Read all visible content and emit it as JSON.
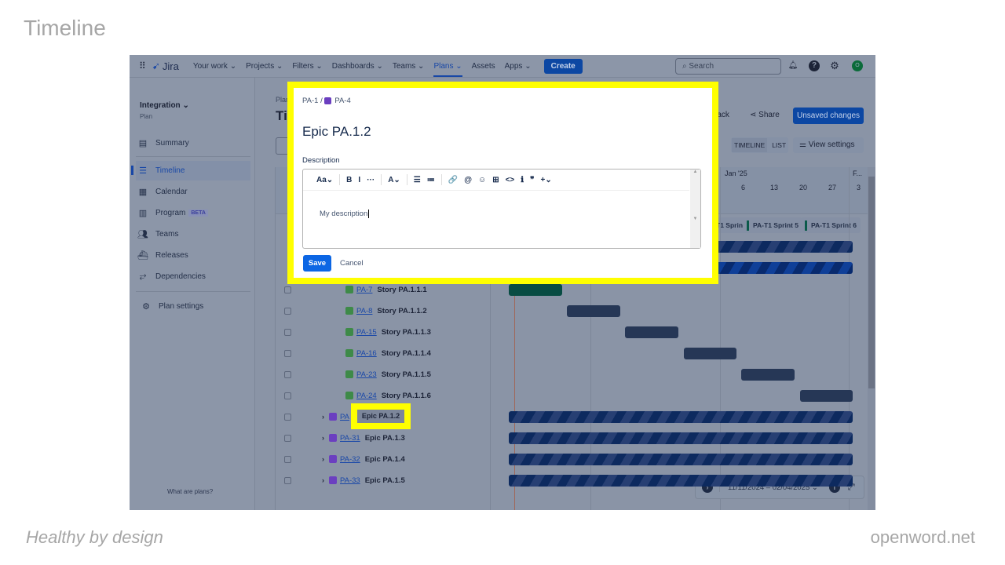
{
  "slide": {
    "title": "Timeline",
    "footer_left": "Healthy by design",
    "footer_right": "openword.net"
  },
  "nav": {
    "product": "Jira",
    "items": [
      "Your work ⌄",
      "Projects ⌄",
      "Filters ⌄",
      "Dashboards ⌄",
      "Teams ⌄",
      "Plans ⌄",
      "Assets",
      "Apps ⌄"
    ],
    "active": "Plans",
    "create": "Create",
    "search_placeholder": "Search",
    "avatar": "O"
  },
  "sidebar": {
    "plan_name": "Integration",
    "plan_type": "Plan",
    "items": [
      {
        "label": "Summary",
        "icon": "summary-icon"
      },
      {
        "label": "Timeline",
        "icon": "timeline-icon"
      },
      {
        "label": "Calendar",
        "icon": "calendar-icon"
      },
      {
        "label": "Program",
        "icon": "program-icon",
        "badge": "BETA"
      },
      {
        "label": "Teams",
        "icon": "teams-icon"
      },
      {
        "label": "Releases",
        "icon": "releases-icon"
      },
      {
        "label": "Dependencies",
        "icon": "dependencies-icon"
      }
    ],
    "settings": "Plan settings",
    "footer": "What are plans?"
  },
  "page": {
    "breadcrumb": "Plans",
    "title": "Timeline",
    "feedback": "Give feedback",
    "share": "Share",
    "unsaved": "Unsaved changes",
    "view_timeline": "TIMELINE",
    "view_list": "LIST",
    "view_settings": "View settings"
  },
  "timeline": {
    "month": "Jan '25",
    "month_next": "F...",
    "weeks": [
      "6",
      "13",
      "20",
      "27",
      "3"
    ],
    "sprints": [
      "PA-T1 Sprint 4",
      "PA-T1 Sprint 5",
      "PA-T1 Sprint 6"
    ],
    "date_range": "11/11/2024 – 02/04/2025"
  },
  "rows": [
    {
      "type": "story",
      "key": "PA-7",
      "title": "Story PA.1.1.1"
    },
    {
      "type": "story",
      "key": "PA-8",
      "title": "Story PA.1.1.2"
    },
    {
      "type": "story",
      "key": "PA-15",
      "title": "Story PA.1.1.3"
    },
    {
      "type": "story",
      "key": "PA-16",
      "title": "Story PA.1.1.4"
    },
    {
      "type": "story",
      "key": "PA-23",
      "title": "Story PA.1.1.5"
    },
    {
      "type": "story",
      "key": "PA-24",
      "title": "Story PA.1.1.6"
    },
    {
      "type": "epic",
      "key": "PA",
      "title": "Epic PA.1.2"
    },
    {
      "type": "epic",
      "key": "PA-31",
      "title": "Epic PA.1.3"
    },
    {
      "type": "epic",
      "key": "PA-32",
      "title": "Epic PA.1.4"
    },
    {
      "type": "epic",
      "key": "PA-33",
      "title": "Epic PA.1.5"
    }
  ],
  "modal": {
    "parent": "PA-1",
    "separator": "/",
    "issue": "PA-4",
    "title": "Epic PA.1.2",
    "description_label": "Description",
    "toolbar": [
      "Aa⌄",
      "B",
      "I",
      "···",
      "A⌄",
      "☰",
      "≔",
      "🔗",
      "@",
      "☺",
      "⊞",
      "<>",
      "ℹ",
      "❞",
      "+⌄"
    ],
    "description_value": "My description",
    "save": "Save",
    "cancel": "Cancel"
  },
  "highlight": {
    "label": "Epic PA.1.2"
  }
}
